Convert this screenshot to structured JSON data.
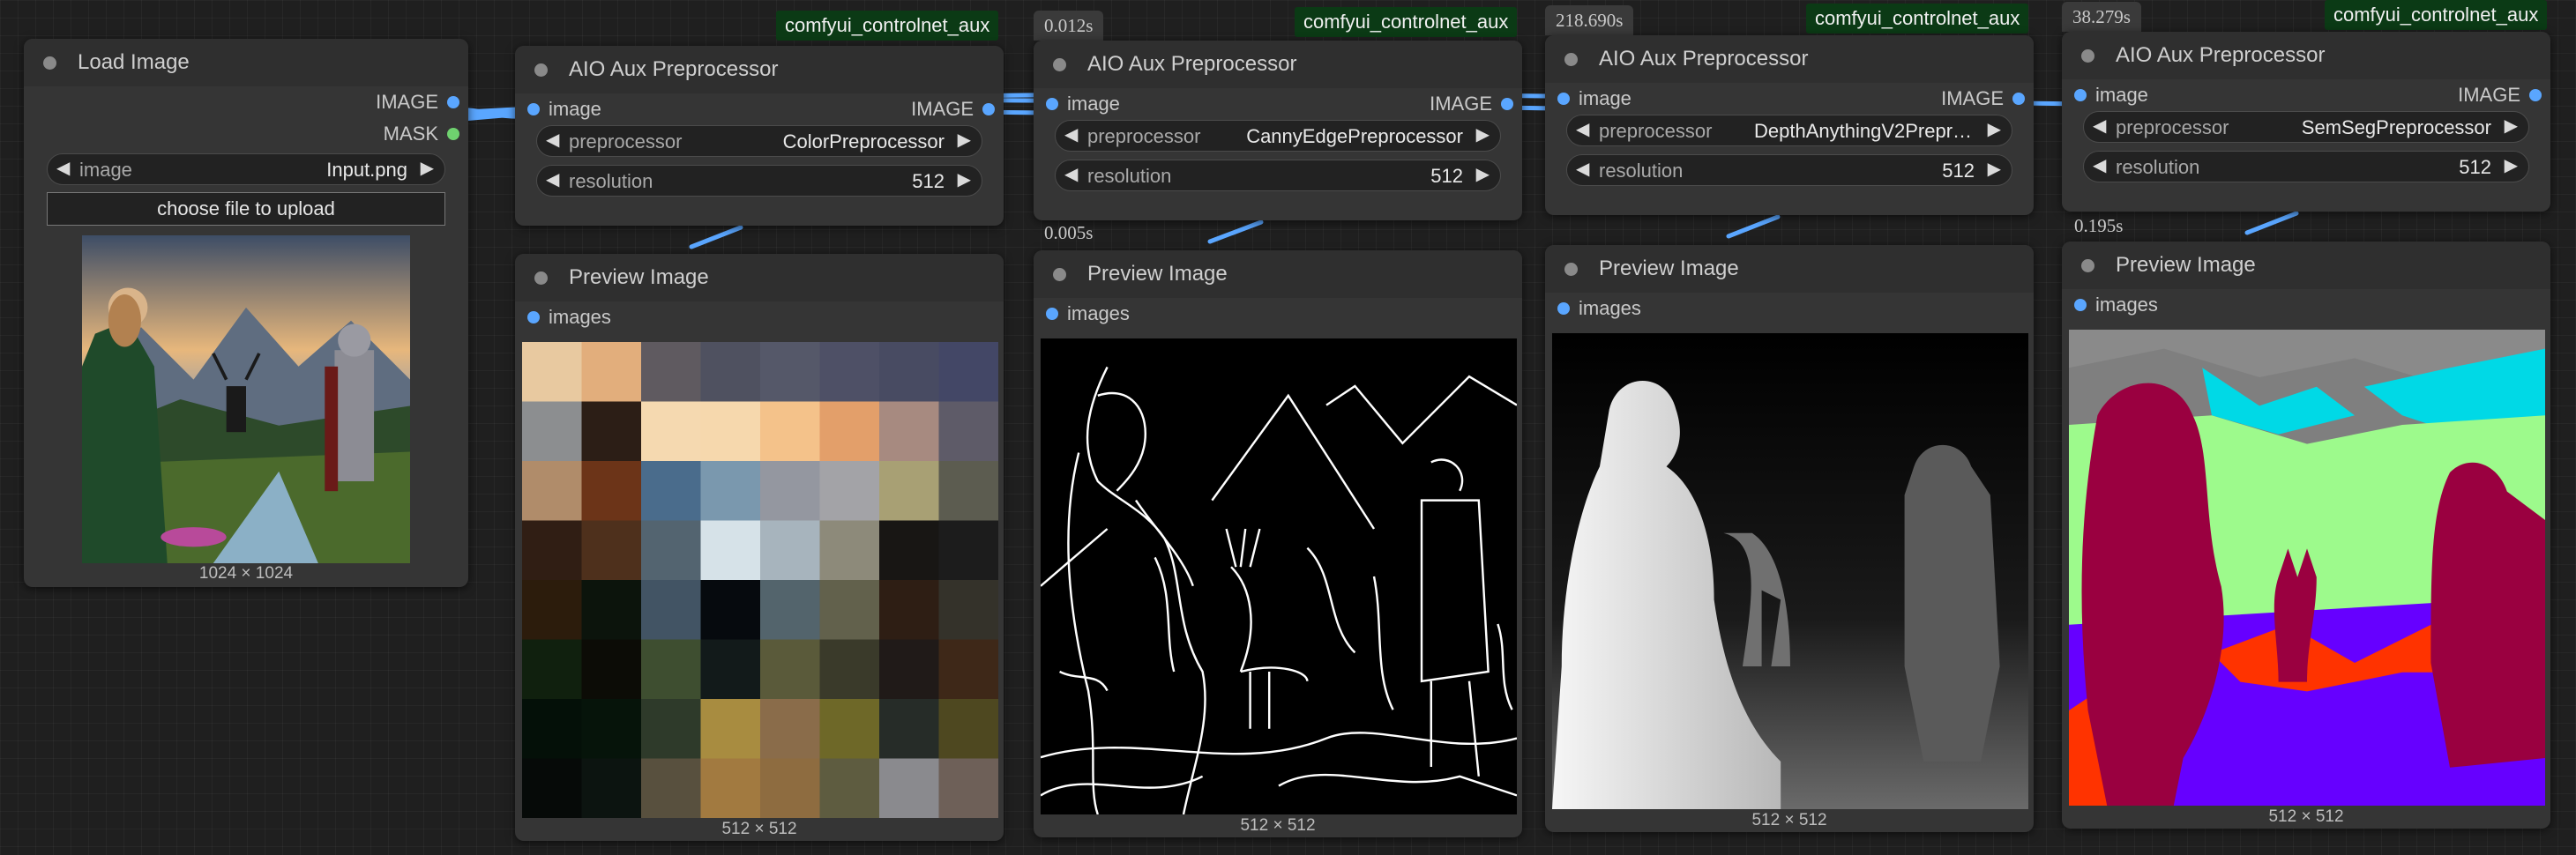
{
  "load_node": {
    "title": "Load Image",
    "outputs": [
      "IMAGE",
      "MASK"
    ],
    "widget_label": "image",
    "widget_value": "Input.png",
    "upload_label": "choose file to upload",
    "size": "1024 × 1024"
  },
  "preprocessors": [
    {
      "title": "AIO Aux Preprocessor",
      "badge": "comfyui_controlnet_aux",
      "timing": "",
      "input": "image",
      "output": "IMAGE",
      "pre_label": "preprocessor",
      "pre_value": "ColorPreprocessor",
      "res_label": "resolution",
      "res_value": "512"
    },
    {
      "title": "AIO Aux Preprocessor",
      "badge": "comfyui_controlnet_aux",
      "timing": "0.012s",
      "input": "image",
      "output": "IMAGE",
      "pre_label": "preprocessor",
      "pre_value": "CannyEdgePreprocessor",
      "res_label": "resolution",
      "res_value": "512"
    },
    {
      "title": "AIO Aux Preprocessor",
      "badge": "comfyui_controlnet_aux",
      "timing": "218.690s",
      "input": "image",
      "output": "IMAGE",
      "pre_label": "preprocessor",
      "pre_value": "DepthAnythingV2Prepro…",
      "res_label": "resolution",
      "res_value": "512"
    },
    {
      "title": "AIO Aux Preprocessor",
      "badge": "comfyui_controlnet_aux",
      "timing": "38.279s",
      "input": "image",
      "output": "IMAGE",
      "pre_label": "preprocessor",
      "pre_value": "SemSegPreprocessor",
      "res_label": "resolution",
      "res_value": "512"
    }
  ],
  "previews": [
    {
      "title": "Preview Image",
      "input": "images",
      "size": "512 × 512",
      "timing": ""
    },
    {
      "title": "Preview Image",
      "input": "images",
      "size": "512 × 512",
      "timing": "0.005s"
    },
    {
      "title": "Preview Image",
      "input": "images",
      "size": "512 × 512",
      "timing": ""
    },
    {
      "title": "Preview Image",
      "input": "images",
      "size": "512 × 512",
      "timing": "0.195s"
    }
  ],
  "colors": {
    "canvas": "#1f1f1f",
    "node_body": "#353535",
    "node_header": "#2f2f2f",
    "link": "#5aa6ff",
    "mask_slot": "#6fd26f",
    "badge": "#0b3a15"
  },
  "color_palette": [
    "#e8c9a0",
    "#e2ae7c",
    "#5f5a60",
    "#4f5160",
    "#555869",
    "#4e5066",
    "#484b62",
    "#434766",
    "#8c8e90",
    "#2c1e16",
    "#f5d9b0",
    "#f6d8ad",
    "#f4c28a",
    "#e39f6a",
    "#a78a80",
    "#5e5b68",
    "#b08c6a",
    "#6c3418",
    "#4a6c8c",
    "#7a98ae",
    "#9497a0",
    "#a3a3a7",
    "#a8a074",
    "#5c5c50",
    "#301e14",
    "#4e301c",
    "#536470",
    "#d6e2e8",
    "#a7b4bd",
    "#8d8a7a",
    "#181614",
    "#1c1c1c",
    "#2c1c0c",
    "#0c140c",
    "#425464",
    "#060a0e",
    "#53646c",
    "#62614c",
    "#2e1e14",
    "#34322a",
    "#10200e",
    "#0c0c06",
    "#3e4e30",
    "#121a1a",
    "#5a5a3a",
    "#3a3a2a",
    "#201a18",
    "#3e2818",
    "#041008",
    "#06140a",
    "#2e3a2a",
    "#a88c40",
    "#8a6c4a",
    "#6e6828",
    "#262c28",
    "#4e4820",
    "#060a08",
    "#0c1410",
    "#58503e",
    "#a27a40",
    "#8e6c40",
    "#5e5c40",
    "#8a8a8e",
    "#6e6058"
  ]
}
